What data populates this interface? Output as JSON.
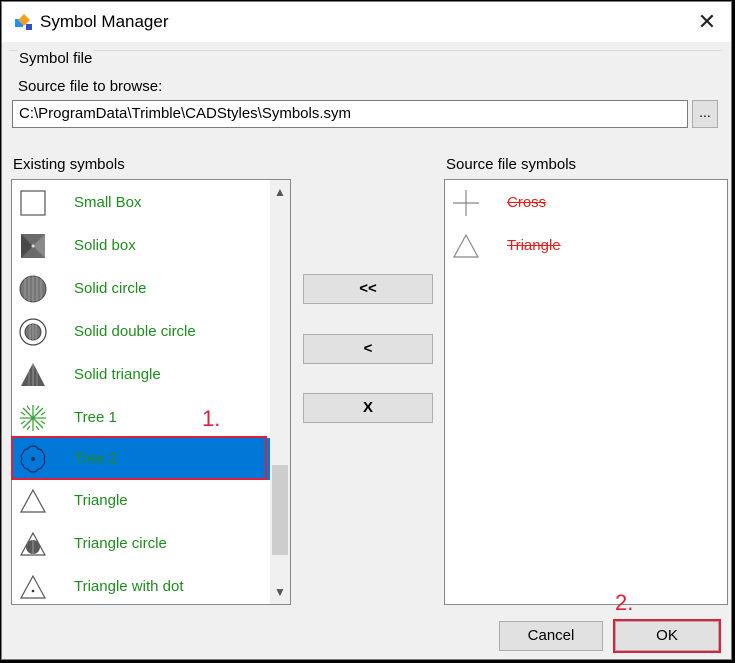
{
  "window": {
    "title": "Symbol Manager"
  },
  "symbol_file": {
    "group_label": "Symbol file",
    "source_label": "Source file to browse:",
    "path_value": "C:\\ProgramData\\Trimble\\CADStyles\\Symbols.sym",
    "browse_label": "..."
  },
  "existing": {
    "label": "Existing symbols",
    "items": [
      {
        "label": "Small Box",
        "icon": "small-box-icon"
      },
      {
        "label": "Solid box",
        "icon": "solid-box-icon"
      },
      {
        "label": "Solid circle",
        "icon": "solid-circle-icon"
      },
      {
        "label": "Solid double circle",
        "icon": "solid-double-circle-icon"
      },
      {
        "label": "Solid triangle",
        "icon": "solid-triangle-icon"
      },
      {
        "label": "Tree 1",
        "icon": "tree-1-icon"
      },
      {
        "label": "Tree 2",
        "icon": "tree-2-icon",
        "selected": true
      },
      {
        "label": "Triangle",
        "icon": "triangle-icon"
      },
      {
        "label": "Triangle circle",
        "icon": "triangle-circle-icon"
      },
      {
        "label": "Triangle with dot",
        "icon": "triangle-with-dot-icon"
      }
    ]
  },
  "source": {
    "label": "Source file symbols",
    "items": [
      {
        "label": "Cross",
        "icon": "cross-icon"
      },
      {
        "label": "Triangle",
        "icon": "triangle-icon"
      }
    ]
  },
  "transfer": {
    "all_label": "<<",
    "one_label": "<",
    "delete_label": "X"
  },
  "footer": {
    "cancel_label": "Cancel",
    "ok_label": "OK"
  },
  "annotations": {
    "step1": "1.",
    "step2": "2."
  },
  "colors": {
    "selection": "#0078d7",
    "item_text": "#1f8b1f",
    "strike_text": "#e02020",
    "annotation": "#e01f3a"
  }
}
